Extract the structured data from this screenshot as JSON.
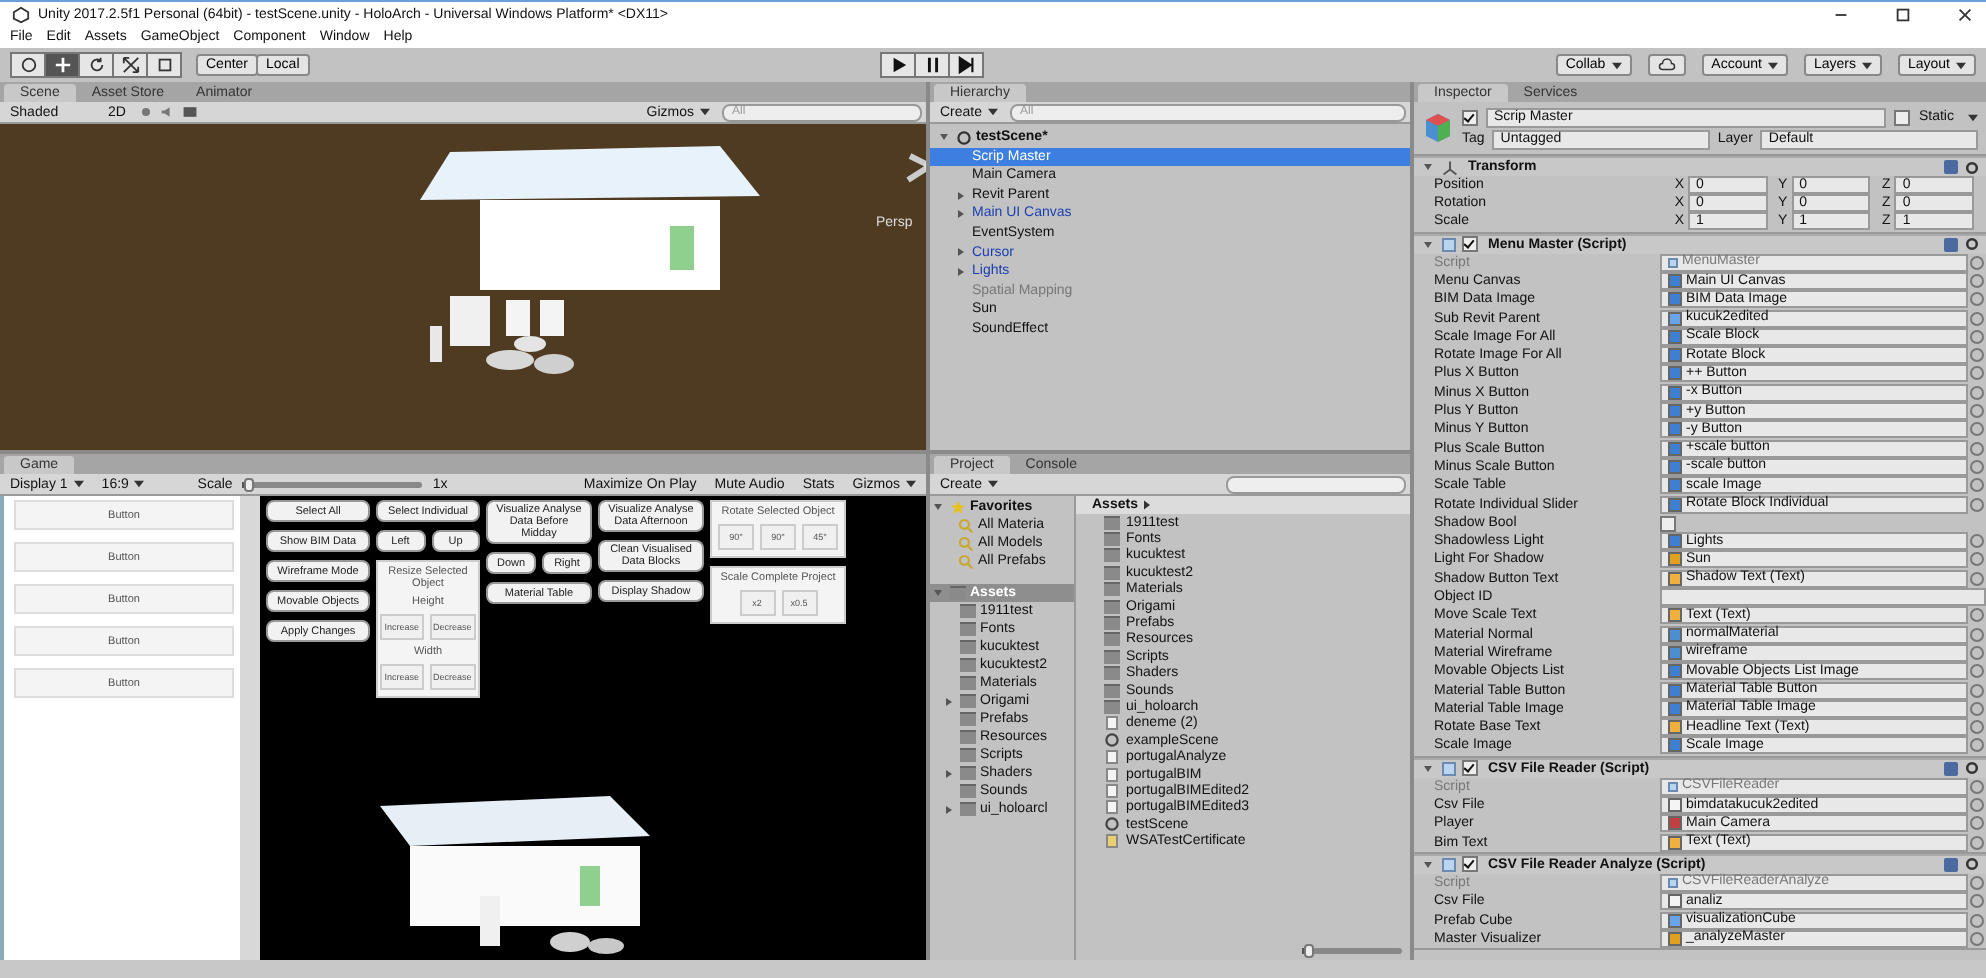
{
  "window": {
    "title": "Unity 2017.2.5f1 Personal (64bit) - testScene.unity - HoloArch - Universal Windows Platform* <DX11>"
  },
  "menu": [
    "File",
    "Edit",
    "Assets",
    "GameObject",
    "Component",
    "Window",
    "Help"
  ],
  "toolbar": {
    "tools": [
      {
        "kind": "hand",
        "selected": false
      },
      {
        "kind": "move",
        "selected": true
      },
      {
        "kind": "rotate",
        "selected": false
      },
      {
        "kind": "scale",
        "selected": false
      },
      {
        "kind": "rect",
        "selected": false
      }
    ],
    "pivot": [
      "Center",
      "Local"
    ],
    "right": [
      "Collab",
      "Account",
      "Layers",
      "Layout"
    ]
  },
  "scene": {
    "tabs": [
      {
        "label": "Scene",
        "selected": true
      },
      {
        "label": "Asset Store",
        "selected": false
      },
      {
        "label": "Animator",
        "selected": false
      }
    ],
    "shading": "Shaded",
    "mode_2d": "2D",
    "gizmos": "Gizmos",
    "search": {
      "placeholder": "All"
    },
    "camera_label": "Persp"
  },
  "game": {
    "tabs": [
      {
        "label": "Game",
        "selected": true
      }
    ],
    "toolbar": {
      "display": "Display 1",
      "aspect": "16:9",
      "scale_label": "Scale",
      "scale_slider": {
        "level": 0.03
      },
      "scale_value": "1x",
      "toggles": [
        {
          "label": "Maximize On Play",
          "on": false
        },
        {
          "label": "Mute Audio",
          "on": false
        },
        {
          "label": "Stats",
          "on": false
        }
      ],
      "gizmos": "Gizmos"
    },
    "list_buttons": [
      "Button",
      "Button",
      "Button",
      "Button",
      "Button"
    ],
    "ui_columns": [
      [
        {
          "kind": "button",
          "label": "Select All"
        },
        {
          "kind": "button",
          "label": "Show BIM Data"
        },
        {
          "kind": "button",
          "label": "Wireframe Mode"
        },
        {
          "kind": "button",
          "label": "Movable Objects"
        },
        {
          "kind": "button",
          "label": "Apply Changes"
        }
      ],
      [
        {
          "kind": "button",
          "label": "Select Individual"
        },
        {
          "kind": "pair",
          "labels": [
            "Left",
            "Up"
          ]
        },
        {
          "kind": "panel",
          "title": "Resize Selected Object",
          "rows": [
            {
              "kind": "label",
              "text": "Height"
            },
            {
              "kind": "buttons",
              "labels": [
                "Increase",
                "Decrease"
              ]
            },
            {
              "kind": "label",
              "text": "Width"
            },
            {
              "kind": "buttons",
              "labels": [
                "Increase",
                "Decrease"
              ]
            }
          ]
        }
      ],
      [
        {
          "kind": "button",
          "label": "Visualize Analyse Data Before Midday"
        },
        {
          "kind": "pair",
          "labels": [
            "Down",
            "Right"
          ]
        },
        {
          "kind": "button",
          "label": "Material Table"
        }
      ],
      [
        {
          "kind": "button",
          "label": "Visualize Analyse Data Afternoon"
        },
        {
          "kind": "button",
          "label": "Clean Visualised Data Blocks"
        },
        {
          "kind": "button",
          "label": "Display Shadow"
        }
      ],
      [
        {
          "kind": "panel",
          "title": "Rotate Selected Object",
          "rows": [
            {
              "kind": "buttons",
              "labels": [
                "90°",
                "90°",
                "45°"
              ]
            }
          ]
        },
        {
          "kind": "panel",
          "title": "Scale Complete Project",
          "rows": [
            {
              "kind": "buttons",
              "labels": [
                "x2",
                "x0.5"
              ]
            }
          ]
        }
      ]
    ]
  },
  "hierarchy": {
    "tab": "Hierarchy",
    "create": "Create",
    "search": {
      "placeholder": "All"
    },
    "scene": {
      "label": "testScene*",
      "expanded": true,
      "children": [
        {
          "label": "Scrip Master",
          "kind": "object",
          "selected": true,
          "prefab": false,
          "inactive": false
        },
        {
          "label": "Main Camera",
          "kind": "object",
          "selected": false,
          "prefab": false,
          "inactive": false
        },
        {
          "label": "Revit Parent",
          "kind": "group",
          "expanded": false,
          "selected": false,
          "prefab": false,
          "inactive": false
        },
        {
          "label": "Main UI Canvas",
          "kind": "group",
          "expanded": false,
          "selected": false,
          "prefab": true,
          "inactive": false
        },
        {
          "label": "EventSystem",
          "kind": "object",
          "selected": false,
          "prefab": false,
          "inactive": false
        },
        {
          "label": "Cursor",
          "kind": "group",
          "expanded": false,
          "selected": false,
          "prefab": true,
          "inactive": false
        },
        {
          "label": "Lights",
          "kind": "group",
          "expanded": false,
          "selected": false,
          "prefab": true,
          "inactive": false
        },
        {
          "label": "Spatial Mapping",
          "kind": "object",
          "selected": false,
          "prefab": false,
          "inactive": true
        },
        {
          "label": "Sun",
          "kind": "object",
          "selected": false,
          "prefab": false,
          "inactive": false
        },
        {
          "label": "SoundEffect",
          "kind": "object",
          "selected": false,
          "prefab": false,
          "inactive": false
        }
      ]
    }
  },
  "project": {
    "tabs": [
      {
        "label": "Project",
        "selected": true
      },
      {
        "label": "Console",
        "selected": false
      }
    ],
    "create": "Create",
    "favorites": {
      "label": "Favorites",
      "expanded": true,
      "children": [
        "All Materia",
        "All Models",
        "All Prefabs"
      ]
    },
    "assets": {
      "label": "Assets",
      "expanded": true,
      "selected": true,
      "children": [
        {
          "label": "1911test",
          "kind": "folder"
        },
        {
          "label": "Fonts",
          "kind": "folder"
        },
        {
          "label": "kucuktest",
          "kind": "folder"
        },
        {
          "label": "kucuktest2",
          "kind": "folder"
        },
        {
          "label": "Materials",
          "kind": "folder"
        },
        {
          "label": "Origami",
          "kind": "group",
          "expanded": false
        },
        {
          "label": "Prefabs",
          "kind": "folder"
        },
        {
          "label": "Resources",
          "kind": "folder"
        },
        {
          "label": "Scripts",
          "kind": "folder"
        },
        {
          "label": "Shaders",
          "kind": "group",
          "expanded": false
        },
        {
          "label": "Sounds",
          "kind": "folder"
        },
        {
          "label": "ui_holoarcl",
          "kind": "group",
          "expanded": false
        }
      ]
    },
    "breadcrumb": "Assets",
    "items": [
      {
        "label": "1911test",
        "kind": "folder"
      },
      {
        "label": "Fonts",
        "kind": "folder"
      },
      {
        "label": "kucuktest",
        "kind": "folder"
      },
      {
        "label": "kucuktest2",
        "kind": "folder"
      },
      {
        "label": "Materials",
        "kind": "folder"
      },
      {
        "label": "Origami",
        "kind": "folder"
      },
      {
        "label": "Prefabs",
        "kind": "folder"
      },
      {
        "label": "Resources",
        "kind": "folder"
      },
      {
        "label": "Scripts",
        "kind": "folder"
      },
      {
        "label": "Shaders",
        "kind": "folder"
      },
      {
        "label": "Sounds",
        "kind": "folder"
      },
      {
        "label": "ui_holoarch",
        "kind": "folder"
      },
      {
        "label": "deneme (2)",
        "kind": "file"
      },
      {
        "label": "exampleScene",
        "kind": "scene"
      },
      {
        "label": "portugalAnalyze",
        "kind": "file"
      },
      {
        "label": "portugalBIM",
        "kind": "file"
      },
      {
        "label": "portugalBIMEdited2",
        "kind": "file"
      },
      {
        "label": "portugalBIMEdited3",
        "kind": "file"
      },
      {
        "label": "testScene",
        "kind": "scene"
      },
      {
        "label": "WSATestCertificate",
        "kind": "certificate"
      }
    ],
    "zoom_slider": {
      "level": 0.05
    }
  },
  "inspector": {
    "tabs": [
      {
        "label": "Inspector",
        "selected": true
      },
      {
        "label": "Services",
        "selected": false
      }
    ],
    "object": {
      "name": "Scrip Master",
      "active": true,
      "static_label": "Static",
      "static": false,
      "tag_label": "Tag",
      "tag": "Untagged",
      "layer_label": "Layer",
      "layer": "Default"
    },
    "components": [
      {
        "kind": "transform",
        "title": "Transform",
        "expanded": true,
        "rows": [
          {
            "label": "Position",
            "values": [
              {
                "axis": "X",
                "value": "0"
              },
              {
                "axis": "Y",
                "value": "0"
              },
              {
                "axis": "Z",
                "value": "0"
              }
            ]
          },
          {
            "label": "Rotation",
            "values": [
              {
                "axis": "X",
                "value": "0"
              },
              {
                "axis": "Y",
                "value": "0"
              },
              {
                "axis": "Z",
                "value": "0"
              }
            ]
          },
          {
            "label": "Scale",
            "values": [
              {
                "axis": "X",
                "value": "1"
              },
              {
                "axis": "Y",
                "value": "1"
              },
              {
                "axis": "Z",
                "value": "1"
              }
            ]
          }
        ]
      },
      {
        "kind": "script",
        "title": "Menu Master (Script)",
        "expanded": true,
        "enabled": true,
        "fields": [
          {
            "label": "Script",
            "kind": "script",
            "value": "MenuMaster"
          },
          {
            "label": "Menu Canvas",
            "kind": "object",
            "value": "Main UI Canvas"
          },
          {
            "label": "BIM Data Image",
            "kind": "object",
            "value": "BIM Data Image"
          },
          {
            "label": "Sub Revit Parent",
            "kind": "prefab",
            "value": "kucuk2edited"
          },
          {
            "label": "Scale Image For All",
            "kind": "object",
            "value": "Scale Block"
          },
          {
            "label": "Rotate Image For All",
            "kind": "object",
            "value": "Rotate Block"
          },
          {
            "label": "Plus X Button",
            "kind": "object",
            "value": "++ Button"
          },
          {
            "label": "Minus X Button",
            "kind": "object",
            "value": "-x Button"
          },
          {
            "label": "Plus Y Button",
            "kind": "object",
            "value": "+y Button"
          },
          {
            "label": "Minus Y Button",
            "kind": "object",
            "value": "-y Button"
          },
          {
            "label": "Plus Scale Button",
            "kind": "object",
            "value": "+scale button"
          },
          {
            "label": "Minus Scale Button",
            "kind": "object",
            "value": "-scale button"
          },
          {
            "label": "Scale Table",
            "kind": "object",
            "value": "scale Image"
          },
          {
            "label": "Rotate Individual Slider",
            "kind": "object",
            "value": "Rotate Block Individual"
          },
          {
            "label": "Shadow Bool",
            "kind": "bool",
            "checked": false
          },
          {
            "label": "Shadowless Light",
            "kind": "object",
            "value": "Lights"
          },
          {
            "label": "Light For Shadow",
            "kind": "light",
            "value": "Sun"
          },
          {
            "label": "Shadow Button Text",
            "kind": "text",
            "value": "Shadow Text (Text)"
          },
          {
            "label": "Object ID",
            "kind": "string"
          },
          {
            "label": "Move Scale Text",
            "kind": "text",
            "value": "Text (Text)"
          },
          {
            "label": "Material Normal",
            "kind": "material",
            "value": "normalMaterial"
          },
          {
            "label": "Material Wireframe",
            "kind": "material",
            "value": "wireframe"
          },
          {
            "label": "Movable Objects List",
            "kind": "object",
            "value": "Movable Objects List Image"
          },
          {
            "label": "Material Table Button",
            "kind": "object",
            "value": "Material Table Button"
          },
          {
            "label": "Material Table Image",
            "kind": "object",
            "value": "Material Table Image"
          },
          {
            "label": "Rotate Base Text",
            "kind": "text",
            "value": "Headline Text (Text)"
          },
          {
            "label": "Scale Image",
            "kind": "object",
            "value": "Scale Image"
          }
        ]
      },
      {
        "kind": "script",
        "title": "CSV File Reader (Script)",
        "expanded": true,
        "enabled": true,
        "fields": [
          {
            "label": "Script",
            "kind": "script",
            "value": "CSVFileReader"
          },
          {
            "label": "Csv File",
            "kind": "file",
            "value": "bimdatakucuk2edited"
          },
          {
            "label": "Player",
            "kind": "camera",
            "value": "Main Camera"
          },
          {
            "label": "Bim Text",
            "kind": "text",
            "value": "Text (Text)"
          }
        ]
      },
      {
        "kind": "script",
        "title": "CSV File Reader Analyze (Script)",
        "expanded": true,
        "enabled": true,
        "fields": [
          {
            "label": "Script",
            "kind": "script",
            "value": "CSVFileReaderAnalyze"
          },
          {
            "label": "Csv File",
            "kind": "file",
            "value": "analiz"
          },
          {
            "label": "Prefab Cube",
            "kind": "prefab",
            "value": "visualizationCube"
          },
          {
            "label": "Master Visualizer",
            "kind": "light",
            "value": "_analyzeMaster"
          }
        ]
      }
    ]
  }
}
